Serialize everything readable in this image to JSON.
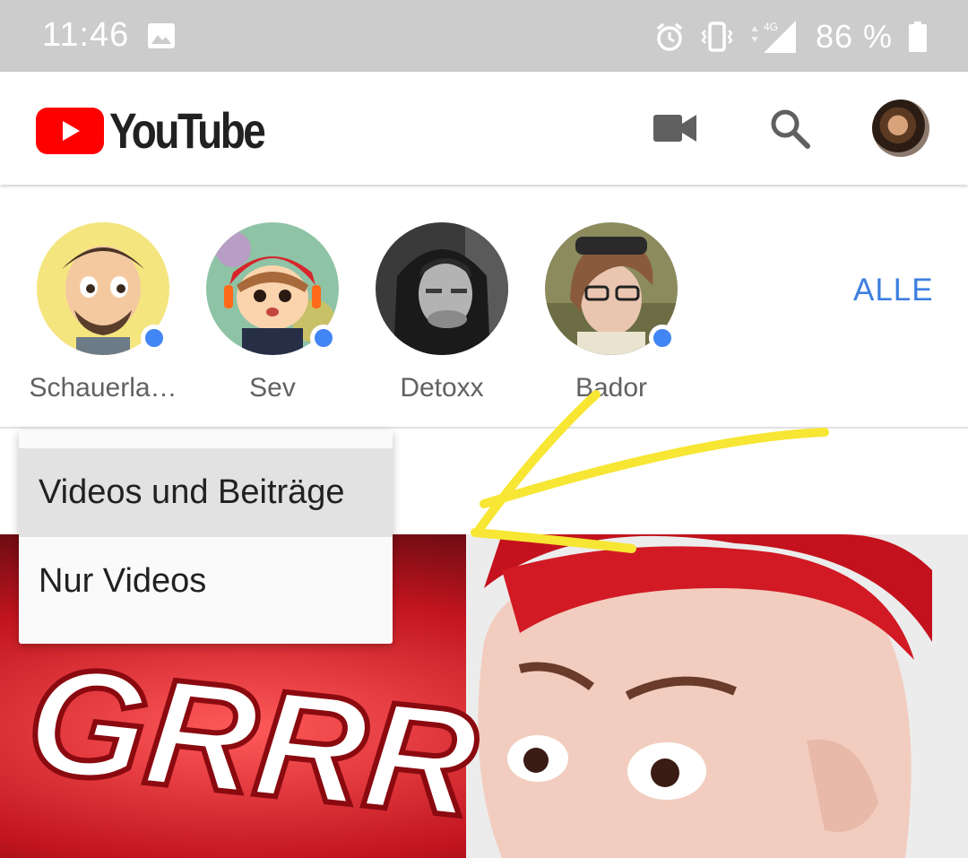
{
  "status_bar": {
    "time": "11:46",
    "battery": "86 %",
    "network": "4G",
    "icons": [
      "image-icon",
      "alarm-icon",
      "vibrate-icon",
      "data-arrows-icon",
      "signal-icon",
      "battery-icon"
    ]
  },
  "app_bar": {
    "logo_text": "YouTube",
    "icons": [
      "camera-icon",
      "search-icon",
      "account-avatar"
    ]
  },
  "channels": {
    "items": [
      {
        "name": "Schauerla…",
        "has_new": true
      },
      {
        "name": "Sev",
        "has_new": true
      },
      {
        "name": "Detoxx",
        "has_new": false
      },
      {
        "name": "Bador",
        "has_new": true
      }
    ],
    "all_label": "ALLE"
  },
  "dropdown": {
    "options": [
      "Videos und Beiträge",
      "Nur Videos"
    ],
    "selected_index": 0
  },
  "thumbnail": {
    "overlay_text": "GRRR"
  },
  "colors": {
    "status_bar": "#cccccc",
    "youtube_red": "#ff0000",
    "accent_blue": "#3d7fe0",
    "new_dot": "#4285f4",
    "annotation": "#f7e633"
  }
}
